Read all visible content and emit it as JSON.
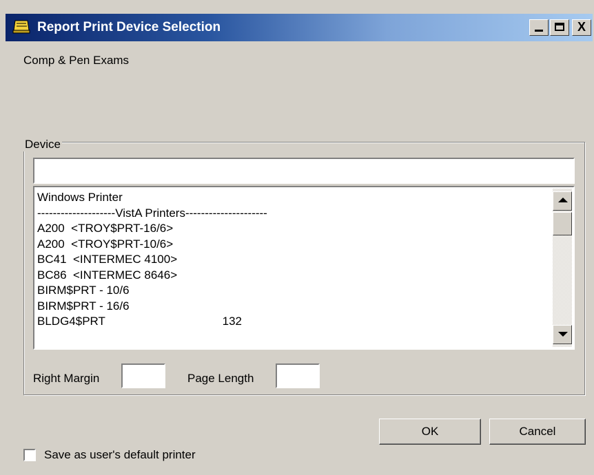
{
  "window": {
    "title": "Report Print Device Selection",
    "minimize_icon": "minimize-icon",
    "maximize_icon": "maximize-icon",
    "close_icon": "close-icon",
    "close_glyph": "X"
  },
  "report_name": "Comp & Pen Exams",
  "device": {
    "group_label": "Device",
    "search_value": "",
    "items": [
      "Windows Printer",
      "--------------------VistA Printers---------------------",
      "A200  <TROY$PRT-16/6>",
      "A200  <TROY$PRT-10/6>",
      "BC41  <INTERMEC 4100>",
      "BC86  <INTERMEC 8646>",
      "BIRM$PRT - 10/6",
      "BIRM$PRT - 16/6",
      "BLDG4$PRT                                    132"
    ],
    "right_margin_label": "Right Margin",
    "right_margin_value": "",
    "page_length_label": "Page Length",
    "page_length_value": ""
  },
  "buttons": {
    "ok": "OK",
    "cancel": "Cancel"
  },
  "save_default_label": "Save as user's default printer"
}
